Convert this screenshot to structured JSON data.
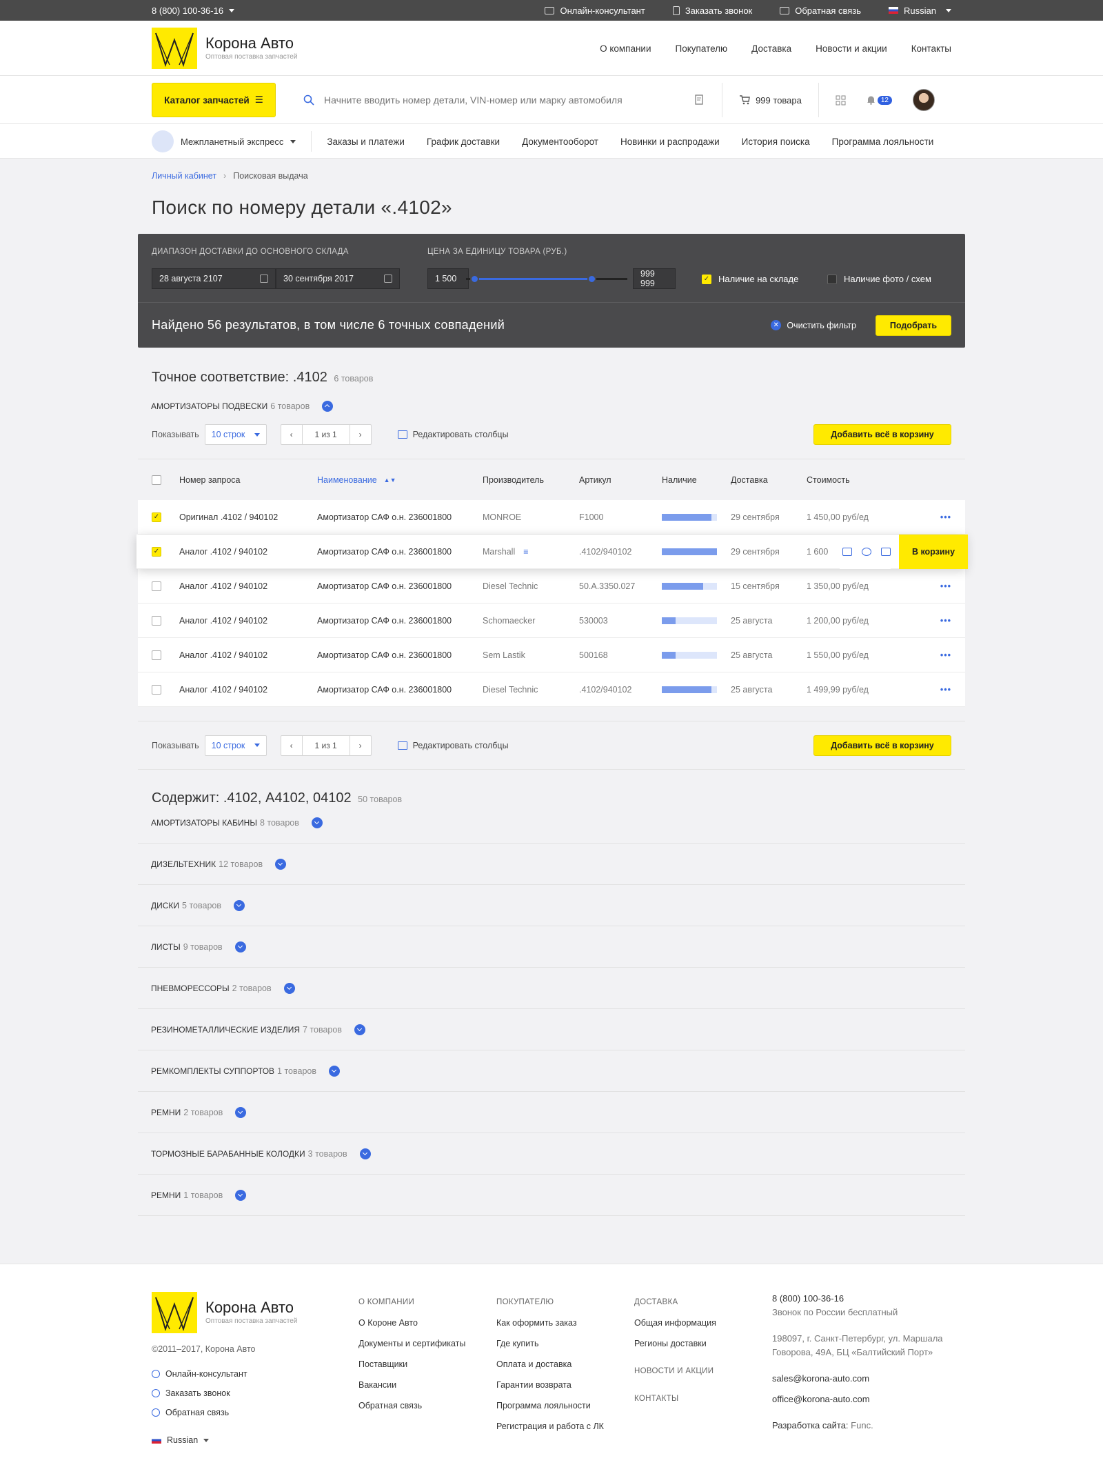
{
  "topbar": {
    "phone": "8 (800) 100-36-16",
    "links": [
      "Онлайн-консультант",
      "Заказать звонок",
      "Обратная связь"
    ],
    "language": "Russian"
  },
  "header": {
    "brand": "Корона Авто",
    "tagline": "Оптовая поставка запчастей",
    "nav": [
      "О компании",
      "Покупателю",
      "Доставка",
      "Новости и акции",
      "Контакты"
    ]
  },
  "searchbar": {
    "catalog_label": "Каталог запчастей",
    "placeholder": "Начните вводить номер детали, VIN-номер или марку автомобиля",
    "cart_label": "999 товара",
    "notifications": "12"
  },
  "subnav": {
    "account": "Межпланетный экспресс",
    "links": [
      "Заказы и платежи",
      "График доставки",
      "Документооборот",
      "Новинки и распродажи",
      "История поиска",
      "Программа лояльности"
    ]
  },
  "breadcrumb": {
    "home": "Личный кабинет",
    "current": "Поисковая выдача"
  },
  "page_title": "Поиск по номеру детали «.4102»",
  "filter": {
    "delivery_label": "Диапазон доставки до основного склада",
    "date_from": "28 августа 2107",
    "date_to": "30 сентября 2017",
    "price_label": "Цена за единицу товара (руб.)",
    "price_min": "1 500",
    "price_max": "999 999",
    "in_stock": "Наличие на складе",
    "has_photo": "Наличие фото / схем",
    "found_text": "Найдено 56 результатов, в том числе 6 точных совпадений",
    "clear": "Очистить фильтр",
    "apply": "Подобрать"
  },
  "exact": {
    "title": "Точное соответствие: .4102",
    "count": "6 товаров",
    "group_name": "Амортизаторы подвески",
    "group_count": "6 товаров",
    "show_label": "Показывать",
    "rows_select": "10 строк",
    "page": "1 из 1",
    "edit_columns": "Редактировать столбцы",
    "add_all": "Добавить всё в корзину",
    "columns": [
      "Номер запроса",
      "Наименование",
      "Производитель",
      "Артикул",
      "Наличие",
      "Доставка",
      "Стоимость"
    ],
    "to_cart": "В корзину",
    "rows": [
      {
        "query": "Оригинал .4102 / 940102",
        "name": "Амортизатор САФ о.н. 236001800",
        "maker": "MONROE",
        "article": "F1000",
        "stock": 0.9,
        "delivery": "29 сентября",
        "price": "1 450,00 руб/ед",
        "checked": "✓"
      },
      {
        "query": "Аналог .4102 / 940102",
        "name": "Амортизатор САФ о.н. 236001800",
        "maker": "Marshall",
        "article": ".4102/940102",
        "stock": 1.0,
        "delivery": "29 сентября",
        "price": "1 600",
        "checked": "✓"
      },
      {
        "query": "Аналог .4102 / 940102",
        "name": "Амортизатор САФ о.н. 236001800",
        "maker": "Diesel Technic",
        "article": "50.A.3350.027",
        "stock": 0.75,
        "delivery": "15 сентября",
        "price": "1 350,00 руб/ед",
        "checked": ""
      },
      {
        "query": "Аналог .4102 / 940102",
        "name": "Амортизатор САФ о.н. 236001800",
        "maker": "Schomaecker",
        "article": "530003",
        "stock": 0.25,
        "delivery": "25 августа",
        "price": "1 200,00 руб/ед",
        "checked": ""
      },
      {
        "query": "Аналог .4102 / 940102",
        "name": "Амортизатор САФ о.н. 236001800",
        "maker": "Sem Lastik",
        "article": "500168",
        "stock": 0.25,
        "delivery": "25 августа",
        "price": "1 550,00 руб/ед",
        "checked": ""
      },
      {
        "query": "Аналог .4102 / 940102",
        "name": "Амортизатор САФ о.н. 236001800",
        "maker": "Diesel Technic",
        "article": ".4102/940102",
        "stock": 0.9,
        "delivery": "25 августа",
        "price": "1 499,99 руб/ед",
        "checked": ""
      }
    ]
  },
  "contains": {
    "title": "Содержит: .4102, А4102, 04102",
    "count": "50 товаров",
    "groups": [
      {
        "name": "Амортизаторы кабины",
        "count": "8 товаров"
      },
      {
        "name": "Дизельтехник",
        "count": "12 товаров"
      },
      {
        "name": "Диски",
        "count": "5 товаров"
      },
      {
        "name": "Листы",
        "count": "9 товаров"
      },
      {
        "name": "Пневмореcсоры",
        "count": "2 товаров"
      },
      {
        "name": "Резинометаллические изделия",
        "count": "7 товаров"
      },
      {
        "name": "Ремкомплекты суппортов",
        "count": "1 товаров"
      },
      {
        "name": "Ремни",
        "count": "2 товаров"
      },
      {
        "name": "Тормозные барабанные колодки",
        "count": "3 товаров"
      },
      {
        "name": "Ремни",
        "count": "1 товаров"
      }
    ]
  },
  "footer": {
    "copyright": "©2011–2017, Корона Авто",
    "links": [
      "Онлайн-консультант",
      "Заказать звонок",
      "Обратная связь"
    ],
    "language": "Russian",
    "col1": {
      "title": "О компании",
      "items": [
        "О Короне Авто",
        "Документы и сертификаты",
        "Поставщики",
        "Вакансии",
        "Обратная связь"
      ]
    },
    "col2": {
      "title": "Покупателю",
      "items": [
        "Как оформить заказ",
        "Где купить",
        "Оплата и доставка",
        "Гарантии возврата",
        "Программа лояльности",
        "Регистрация и работа с ЛК"
      ]
    },
    "col3": {
      "title": "Доставка",
      "items": [
        "Общая информация",
        "Регионы доставки"
      ],
      "extra": [
        "Новости и акции",
        "Контакты"
      ]
    },
    "contact": {
      "phone": "8 (800) 100-36-16",
      "phone_note": "Звонок по России бесплатный",
      "address": "198097, г. Санкт-Петербург, ул. Маршала Говорова, 49А, БЦ «Балтийский Порт»",
      "email1": "sales@korona-auto.com",
      "email2": "office@korona-auto.com",
      "dev_label": "Разработка сайта:",
      "dev": "Func."
    }
  },
  "colors": {
    "accent": "#ffea00",
    "link": "#3a6ae0",
    "dark": "#4a4a4c"
  }
}
